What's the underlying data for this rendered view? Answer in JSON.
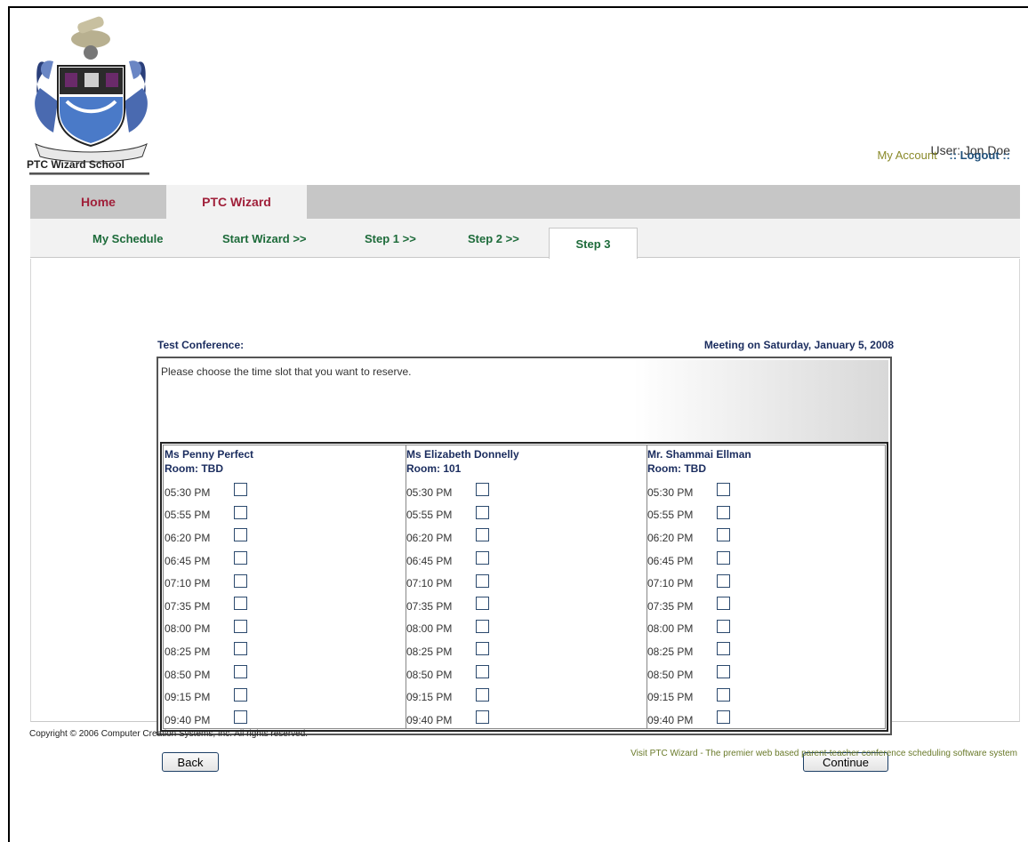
{
  "header": {
    "school_name": "PTC Wizard School",
    "user_label": "User: Jon Doe",
    "my_account": "My Account",
    "logout_prefix": "::",
    "logout": "Logout",
    "logout_suffix": "::"
  },
  "tabs": [
    "Home",
    "PTC Wizard"
  ],
  "subtabs": [
    "My Schedule",
    "Start Wizard >>",
    "Step 1 >>",
    "Step 2 >>",
    "Step 3"
  ],
  "conference": {
    "title": "Test Conference:",
    "meeting": "Meeting on Saturday, January 5, 2008",
    "instructions": "Please choose the time slot that you want to reserve."
  },
  "teachers": [
    {
      "name": "Ms Penny Perfect",
      "room": "Room: TBD"
    },
    {
      "name": "Ms Elizabeth Donnelly",
      "room": "Room: 101"
    },
    {
      "name": "Mr. Shammai Ellman",
      "room": "Room: TBD"
    }
  ],
  "time_slots": [
    "05:30 PM",
    "05:55 PM",
    "06:20 PM",
    "06:45 PM",
    "07:10 PM",
    "07:35 PM",
    "08:00 PM",
    "08:25 PM",
    "08:50 PM",
    "09:15 PM",
    "09:40 PM"
  ],
  "buttons": {
    "back": "Back",
    "continue": "Continue"
  },
  "footer": {
    "copyright": "Copyright © 2006 Computer Creation Systems, Inc. All rights reserved.",
    "visit": "Visit PTC Wizard - The premier web based parent-teacher conference scheduling software system"
  },
  "colors": {
    "tab_text": "#a0203a",
    "subtab_text": "#1d6b3a",
    "heading_text": "#1a2c5e",
    "tabbar_bg": "#c6c6c6"
  }
}
